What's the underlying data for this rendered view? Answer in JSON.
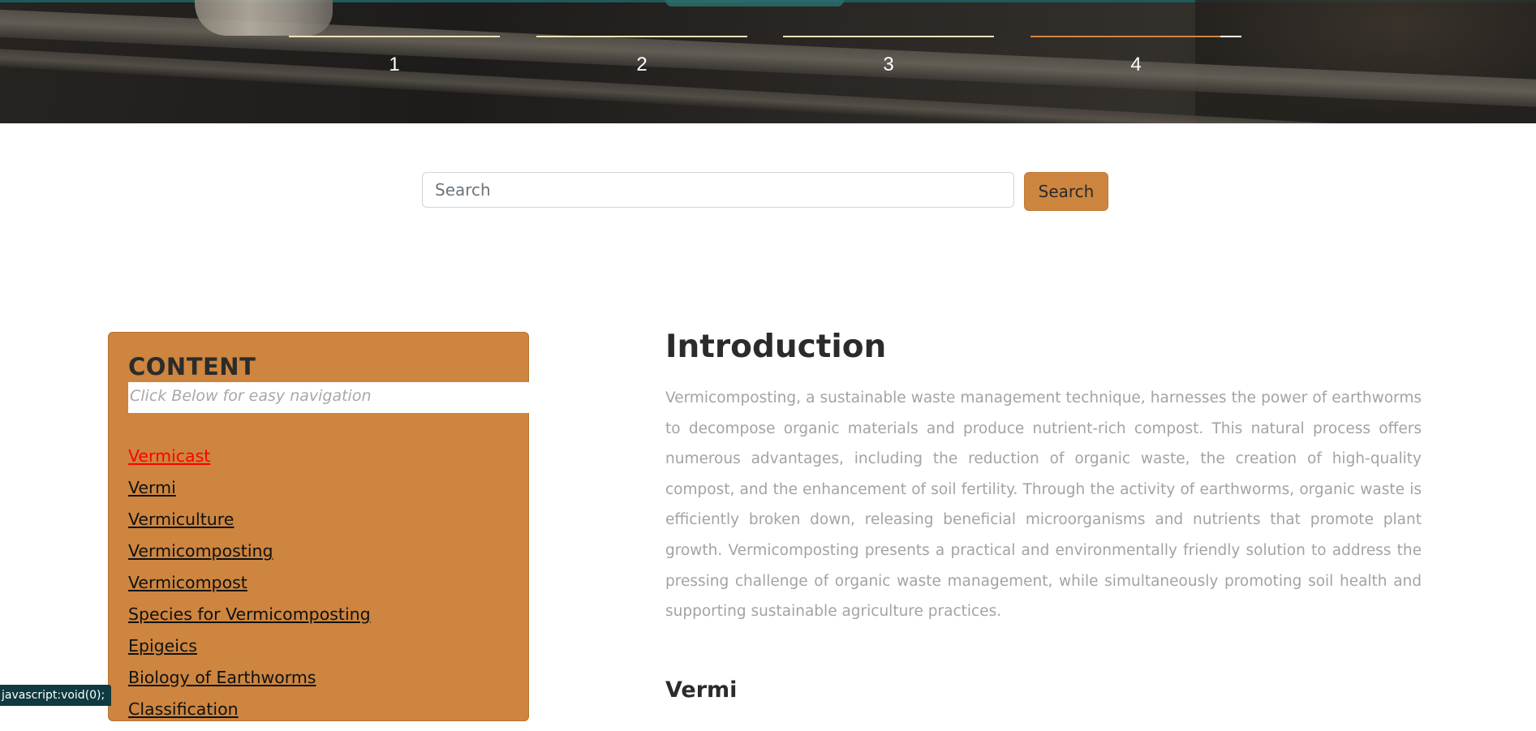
{
  "hero": {
    "steps": [
      "1",
      "2",
      "3",
      "4"
    ],
    "active_step": 4
  },
  "search": {
    "placeholder": "Search",
    "value": "",
    "button_label": "Search"
  },
  "toc": {
    "title": "CONTENT",
    "subtitle": "Click Below for easy navigation",
    "items": [
      {
        "label": "Vermicast",
        "active": true
      },
      {
        "label": "Vermi",
        "active": false
      },
      {
        "label": "Vermiculture",
        "active": false
      },
      {
        "label": "Vermicomposting",
        "active": false
      },
      {
        "label": "Vermicompost",
        "active": false
      },
      {
        "label": "Species for Vermicomposting",
        "active": false
      },
      {
        "label": "Epigeics",
        "active": false
      },
      {
        "label": "Biology of Earthworms",
        "active": false
      },
      {
        "label": "Classification",
        "active": false
      }
    ]
  },
  "article": {
    "heading": "Introduction",
    "paragraph": "Vermicomposting, a sustainable waste management technique, harnesses the power of earthworms to decompose organic materials and produce nutrient-rich compost. This natural process offers numerous advantages, including the reduction of organic waste, the creation of high-quality compost, and the enhancement of soil fertility. Through the activity of earthworms, organic waste is efficiently broken down, releasing beneficial microorganisms and nutrients that promote plant growth. Vermicomposting presents a practical and environmentally friendly solution to address the pressing challenge of organic waste management, while simultaneously promoting soil health and supporting sustainable agriculture practices.",
    "next_heading": "Vermi"
  },
  "status_bar": {
    "text": "javascript:void(0);"
  },
  "colors": {
    "accent": "#cd853f",
    "active_link": "#ff0000",
    "status_bar_bg": "#0f3a3f"
  }
}
